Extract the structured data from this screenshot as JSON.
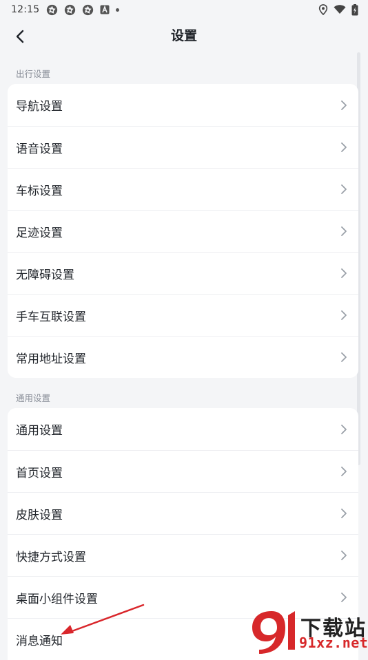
{
  "status_bar": {
    "time": "12:15",
    "left_icons": [
      "aperture-icon",
      "aperture-icon",
      "aperture-icon",
      "a-badge-icon"
    ],
    "right_icons": [
      "location-icon",
      "wifi-icon",
      "battery-charging-icon"
    ]
  },
  "header": {
    "title": "设置",
    "back_icon": "chevron-left-icon"
  },
  "sections": [
    {
      "label": "出行设置",
      "items": [
        "导航设置",
        "语音设置",
        "车标设置",
        "足迹设置",
        "无障碍设置",
        "手车互联设置",
        "常用地址设置"
      ]
    },
    {
      "label": "通用设置",
      "items": [
        "通用设置",
        "首页设置",
        "皮肤设置",
        "快捷方式设置",
        "桌面小组件设置",
        "消息通知"
      ]
    }
  ],
  "watermark": {
    "top_text": "下载站",
    "bottom_text": "91xz.net"
  },
  "colors": {
    "background": "#f4f5f7",
    "card": "#ffffff",
    "text": "#1f2329",
    "section_label": "#8a8f99",
    "chevron": "#9aa0a8",
    "annotation_arrow": "#d9262b",
    "watermark_red": "#d7282a"
  }
}
